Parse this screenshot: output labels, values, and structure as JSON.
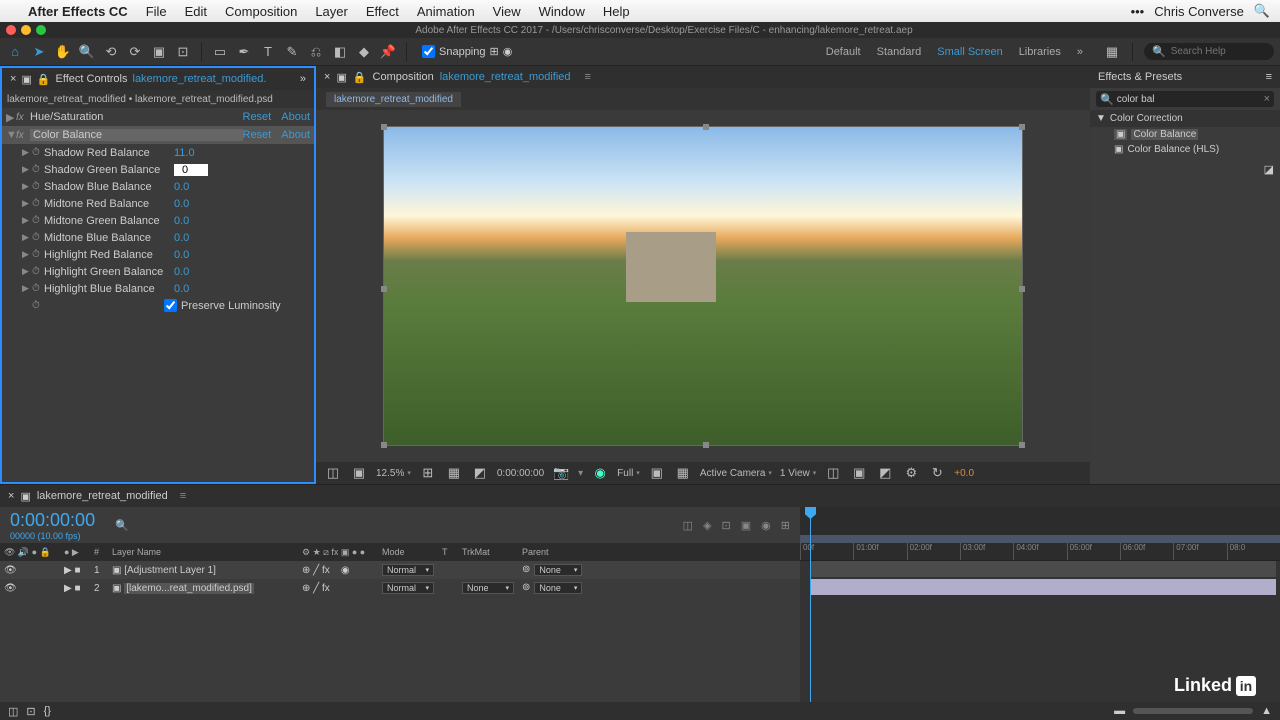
{
  "menubar": {
    "app": "After Effects CC",
    "items": [
      "File",
      "Edit",
      "Composition",
      "Layer",
      "Effect",
      "Animation",
      "View",
      "Window",
      "Help"
    ],
    "user": "Chris Converse"
  },
  "title": "Adobe After Effects CC 2017 - /Users/chrisconverse/Desktop/Exercise Files/C - enhancing/lakemore_retreat.aep",
  "toolbar": {
    "snapping_label": "Snapping",
    "workspaces": [
      "Default",
      "Standard",
      "Small Screen",
      "Libraries"
    ],
    "active_workspace": "Small Screen",
    "search_placeholder": "Search Help"
  },
  "effect_controls": {
    "panel_label": "Effect Controls",
    "target": "lakemore_retreat_modified.",
    "breadcrumb": "lakemore_retreat_modified • lakemore_retreat_modified.psd",
    "effects": [
      {
        "name": "Hue/Saturation",
        "reset": "Reset",
        "about": "About",
        "expanded": false,
        "selected": false
      },
      {
        "name": "Color Balance",
        "reset": "Reset",
        "about": "About",
        "expanded": true,
        "selected": true
      }
    ],
    "properties": [
      {
        "name": "Shadow Red Balance",
        "value": "11.0"
      },
      {
        "name": "Shadow Green Balance",
        "value": "0",
        "editing": true
      },
      {
        "name": "Shadow Blue Balance",
        "value": "0.0"
      },
      {
        "name": "Midtone Red Balance",
        "value": "0.0"
      },
      {
        "name": "Midtone Green Balance",
        "value": "0.0"
      },
      {
        "name": "Midtone Blue Balance",
        "value": "0.0"
      },
      {
        "name": "Highlight Red Balance",
        "value": "0.0"
      },
      {
        "name": "Highlight Green Balance",
        "value": "0.0"
      },
      {
        "name": "Highlight Blue Balance",
        "value": "0.0"
      }
    ],
    "preserve_luminosity": "Preserve Luminosity"
  },
  "composition": {
    "panel_label": "Composition",
    "name": "lakemore_retreat_modified",
    "zoom": "12.5%",
    "timecode": "0:00:00:00",
    "resolution": "Full",
    "camera": "Active Camera",
    "views": "1 View",
    "exposure": "+0.0"
  },
  "effects_presets": {
    "title": "Effects & Presets",
    "search_value": "color bal",
    "category": "Color Correction",
    "items": [
      "Color Balance",
      "Color Balance (HLS)"
    ]
  },
  "timeline": {
    "comp_name": "lakemore_retreat_modified",
    "timecode": "0:00:00:00",
    "frame_info": "00000 (10.00 fps)",
    "columns": {
      "num": "#",
      "layer": "Layer Name",
      "mode": "Mode",
      "t": "T",
      "trkmat": "TrkMat",
      "parent": "Parent"
    },
    "layers": [
      {
        "num": "1",
        "name": "[Adjustment Layer 1]",
        "mode": "Normal",
        "trkmat": "",
        "parent": "None",
        "selected": false
      },
      {
        "num": "2",
        "name": "[lakemo...reat_modified.psd]",
        "mode": "Normal",
        "trkmat": "None",
        "parent": "None",
        "selected": true
      }
    ],
    "ruler_ticks": [
      "00f",
      "01:00f",
      "02:00f",
      "03:00f",
      "04:00f",
      "05:00f",
      "06:00f",
      "07:00f",
      "08:0"
    ]
  }
}
